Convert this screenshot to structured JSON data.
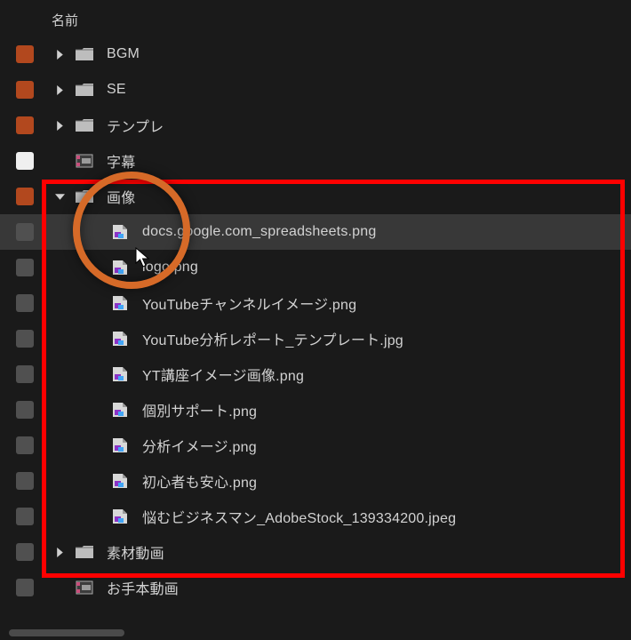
{
  "header": {
    "name_col": "名前"
  },
  "label_colors": {
    "orange": "#b2481e",
    "white": "#efefef",
    "grey": "#505050"
  },
  "rows": [
    {
      "kind": "bin",
      "label": "orange",
      "expanded": false,
      "name": "BGM"
    },
    {
      "kind": "bin",
      "label": "orange",
      "expanded": false,
      "name": "SE"
    },
    {
      "kind": "bin",
      "label": "orange",
      "expanded": false,
      "name": "テンプレ"
    },
    {
      "kind": "seq",
      "label": "white",
      "name": "字幕"
    },
    {
      "kind": "bin",
      "label": "orange",
      "expanded": true,
      "name": "画像"
    },
    {
      "kind": "file",
      "label": "grey",
      "selected": true,
      "name": "docs.google.com_spreadsheets.png"
    },
    {
      "kind": "file",
      "label": "grey",
      "name": "logo.png"
    },
    {
      "kind": "file",
      "label": "grey",
      "name": "YouTubeチャンネルイメージ.png"
    },
    {
      "kind": "file",
      "label": "grey",
      "name": "YouTube分析レポート_テンプレート.jpg"
    },
    {
      "kind": "file",
      "label": "grey",
      "name": "YT講座イメージ画像.png"
    },
    {
      "kind": "file",
      "label": "grey",
      "name": "個別サポート.png"
    },
    {
      "kind": "file",
      "label": "grey",
      "name": "分析イメージ.png"
    },
    {
      "kind": "file",
      "label": "grey",
      "name": "初心者も安心.png"
    },
    {
      "kind": "file",
      "label": "grey",
      "name": "悩むビジネスマン_AdobeStock_139334200.jpeg"
    },
    {
      "kind": "bin",
      "label": "grey",
      "expanded": false,
      "name": "素材動画"
    },
    {
      "kind": "seq",
      "label": "grey",
      "name": "お手本動画"
    }
  ]
}
